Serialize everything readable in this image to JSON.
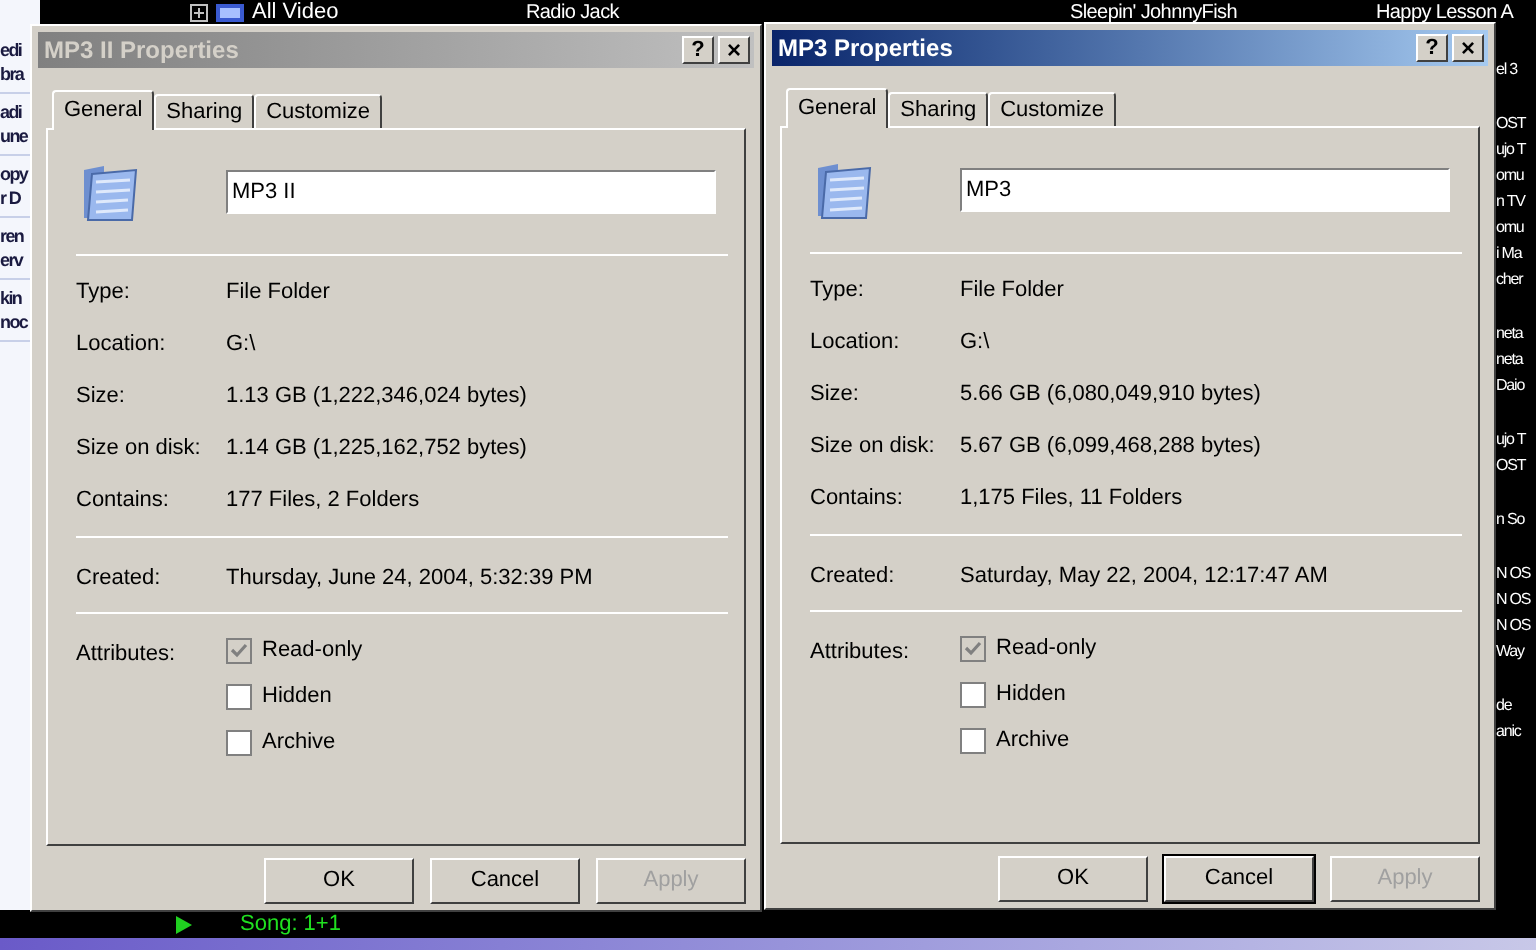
{
  "background": {
    "tree_item": "All Video",
    "headers": [
      "Radio Jack",
      "Sleepin' JohnnyFish",
      "Happy Lesson A"
    ],
    "sidebar_groups": [
      {
        "lines": [
          "edi",
          "bra"
        ]
      },
      {
        "lines": [
          "adi",
          "une"
        ]
      },
      {
        "lines": [
          "opy",
          "r D"
        ]
      },
      {
        "lines": [
          "ren",
          "erv"
        ]
      },
      {
        "lines": [
          "kin",
          "noc"
        ]
      }
    ],
    "right_groups": [
      {
        "lines": [
          "el 3"
        ]
      },
      {
        "lines": [
          "OST",
          "ujo T",
          "omu",
          "n TV",
          "omu",
          "i Ma",
          "cher"
        ]
      },
      {
        "lines": [
          "neta",
          "neta",
          "Daio"
        ]
      },
      {
        "lines": [
          "ujo T",
          "OST"
        ]
      },
      {
        "lines": [
          "n So"
        ]
      },
      {
        "lines": [
          "N OS",
          "N OS",
          "N OS",
          "Way"
        ]
      },
      {
        "lines": [
          "de",
          "anic"
        ]
      }
    ],
    "now_playing": "Song: 1+1"
  },
  "dialogs": [
    {
      "title": "MP3 II Properties",
      "active": false,
      "help": "?",
      "close": "×",
      "tabs": [
        {
          "label": "General",
          "selected": true
        },
        {
          "label": "Sharing",
          "selected": false
        },
        {
          "label": "Customize",
          "selected": false
        }
      ],
      "name": "MP3 II",
      "properties": [
        {
          "label": "Type:",
          "value": "File Folder"
        },
        {
          "label": "Location:",
          "value": "G:\\"
        },
        {
          "label": "Size:",
          "value": "1.13 GB (1,222,346,024 bytes)"
        },
        {
          "label": "Size on disk:",
          "value": "1.14 GB (1,225,162,752 bytes)"
        },
        {
          "label": "Contains:",
          "value": "177 Files, 2 Folders"
        }
      ],
      "created": {
        "label": "Created:",
        "value": "Thursday, June 24, 2004, 5:32:39 PM"
      },
      "attributes_label": "Attributes:",
      "attributes": [
        {
          "label": "Read-only",
          "checked": true,
          "mixed": true
        },
        {
          "label": "Hidden",
          "checked": false,
          "mixed": false
        },
        {
          "label": "Archive",
          "checked": false,
          "mixed": false
        }
      ],
      "buttons": [
        {
          "label": "OK",
          "disabled": false,
          "default": false
        },
        {
          "label": "Cancel",
          "disabled": false,
          "default": false
        },
        {
          "label": "Apply",
          "disabled": true,
          "default": false
        }
      ]
    },
    {
      "title": "MP3 Properties",
      "active": true,
      "help": "?",
      "close": "×",
      "tabs": [
        {
          "label": "General",
          "selected": true
        },
        {
          "label": "Sharing",
          "selected": false
        },
        {
          "label": "Customize",
          "selected": false
        }
      ],
      "name": "MP3",
      "properties": [
        {
          "label": "Type:",
          "value": "File Folder"
        },
        {
          "label": "Location:",
          "value": "G:\\"
        },
        {
          "label": "Size:",
          "value": "5.66 GB (6,080,049,910 bytes)"
        },
        {
          "label": "Size on disk:",
          "value": "5.67 GB (6,099,468,288 bytes)"
        },
        {
          "label": "Contains:",
          "value": "1,175 Files, 11 Folders"
        }
      ],
      "created": {
        "label": "Created:",
        "value": "Saturday, May 22, 2004, 12:17:47 AM"
      },
      "attributes_label": "Attributes:",
      "attributes": [
        {
          "label": "Read-only",
          "checked": true,
          "mixed": true
        },
        {
          "label": "Hidden",
          "checked": false,
          "mixed": false
        },
        {
          "label": "Archive",
          "checked": false,
          "mixed": false
        }
      ],
      "buttons": [
        {
          "label": "OK",
          "disabled": false,
          "default": false
        },
        {
          "label": "Cancel",
          "disabled": false,
          "default": true
        },
        {
          "label": "Apply",
          "disabled": true,
          "default": false
        }
      ]
    }
  ]
}
